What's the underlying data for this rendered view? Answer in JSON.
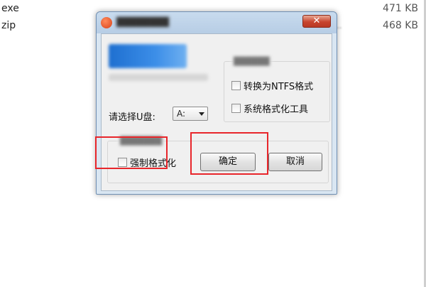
{
  "files": [
    {
      "name": "exe",
      "size": "471 KB",
      "meta": ""
    },
    {
      "name": "zip",
      "size": "468 KB",
      "meta": "..."
    }
  ],
  "dialog": {
    "close_label": "✕",
    "drive_label": "请选择U盘:",
    "drive_value": "A:",
    "options": {
      "ntfs_label": "转换为NTFS格式",
      "system_tool_label": "系统格式化工具"
    },
    "force_format_label": "强制格式化",
    "ok_label": "确定",
    "cancel_label": "取消"
  },
  "highlight_color": "#e8262b"
}
